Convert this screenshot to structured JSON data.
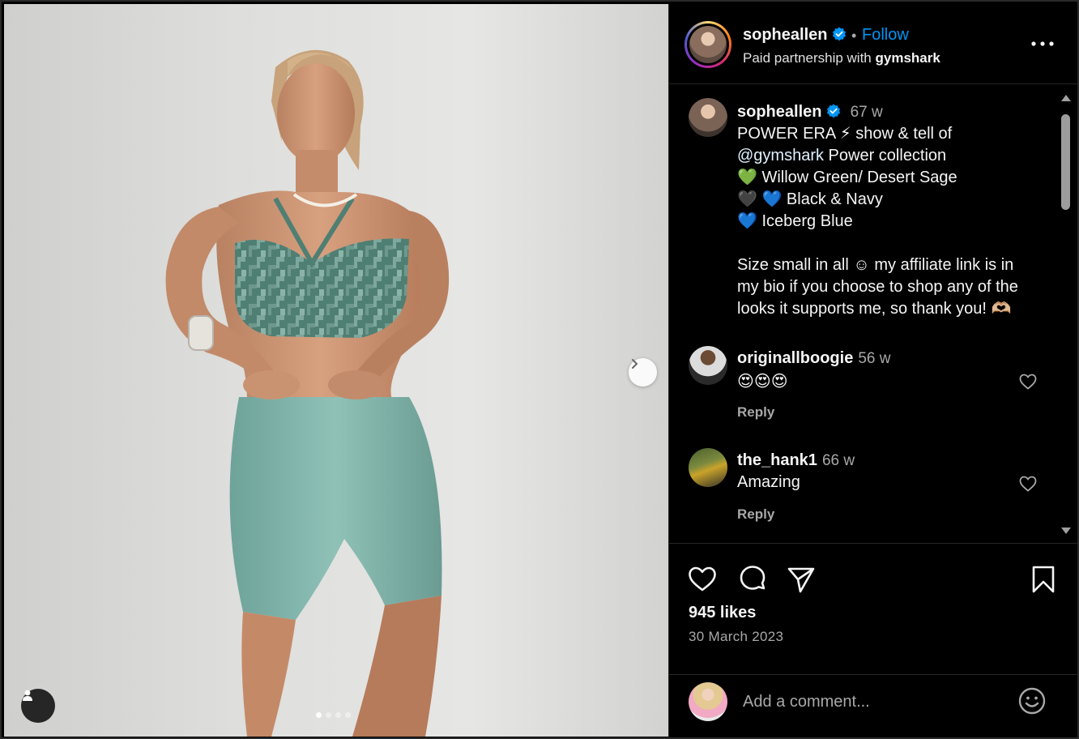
{
  "post": {
    "carousel": {
      "slide_count": 4,
      "active_index": 0
    }
  },
  "header": {
    "username": "sopheallen",
    "separator": "•",
    "follow_label": "Follow",
    "partnership_prefix": "Paid partnership with ",
    "partner": "gymshark"
  },
  "caption": {
    "username": "sopheallen",
    "time": "67 w",
    "line1": "POWER ERA ⚡ show & tell of",
    "mention": "@gymshark",
    "line2_rest": " Power collection",
    "line3": "💚 Willow Green/ Desert Sage",
    "line4": "🖤 💙 Black & Navy",
    "line5": "💙 Iceberg Blue",
    "line6": "Size small in all ☺ my affiliate link is in",
    "line7": "my bio if you choose to shop any of the",
    "line8": "looks it supports me, so thank you! 🫶🏼"
  },
  "comments": [
    {
      "username": "originallboogie",
      "time": "56 w",
      "text": "😍😍😍",
      "reply_label": "Reply"
    },
    {
      "username": "the_hank1",
      "time": "66 w",
      "text": "Amazing",
      "reply_label": "Reply"
    }
  ],
  "stats": {
    "likes": "945 likes",
    "date": "30 March 2023"
  },
  "composer": {
    "placeholder": "Add a comment..."
  },
  "colors": {
    "accent": "#0095f6",
    "background": "#000000",
    "muted": "#a8a8a8"
  }
}
